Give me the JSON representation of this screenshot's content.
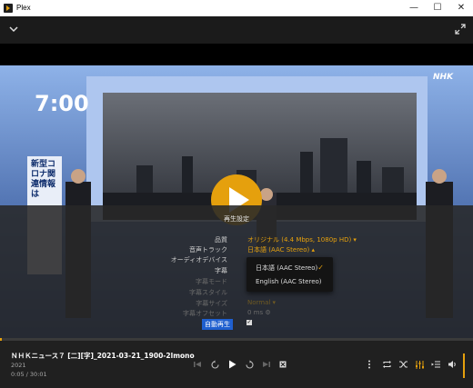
{
  "window": {
    "title": "Plex",
    "minimize_glyph": "—",
    "maximize_glyph": "☐",
    "close_glyph": "✕"
  },
  "video": {
    "clock": "7:00",
    "broadcaster_logo": "NHK",
    "side_banner": "新型コロナ関連情報は"
  },
  "settings_panel": {
    "title": "再生設定",
    "rows": [
      {
        "label": "品質",
        "value": "オリジナル (4.4 Mbps, 1080p HD) ▾"
      },
      {
        "label": "音声トラック",
        "value": "日本語 (AAC Stereo) ▴"
      },
      {
        "label": "オーディオデバイス",
        "value": ""
      },
      {
        "label": "字幕",
        "value": ""
      },
      {
        "label": "字幕モード",
        "value": ""
      },
      {
        "label": "字幕スタイル",
        "value": ""
      },
      {
        "label": "字幕サイズ",
        "value": "Normal ▾"
      },
      {
        "label": "字幕オフセット",
        "value": "0 ms ⚙"
      }
    ],
    "autoplay_label": "自動再生",
    "autoplay_checked": "✓",
    "audio_dropdown": {
      "options": [
        "日本語 (AAC Stereo)",
        "English (AAC Stereo)"
      ],
      "selected_mark": "✓"
    }
  },
  "now_playing": {
    "title": "ＮＨＫニュース７ [二][字]_2021-03-21_1900-2lmono",
    "year": "2021",
    "time": "0:05 / 30:01",
    "progress": 0.003
  },
  "colors": {
    "accent": "#e5a00d",
    "panel": "#2a2a2a",
    "control_bar": "#202020"
  },
  "icons": [
    "collapse-icon",
    "fullscreen-icon",
    "play-icon",
    "skip-previous-icon",
    "replay-10-icon",
    "pause-icon",
    "forward-30-icon",
    "skip-next-icon",
    "stop-icon",
    "more-icon",
    "repeat-icon",
    "shuffle-icon",
    "settings-sliders-icon",
    "playlist-icon",
    "volume-icon"
  ]
}
